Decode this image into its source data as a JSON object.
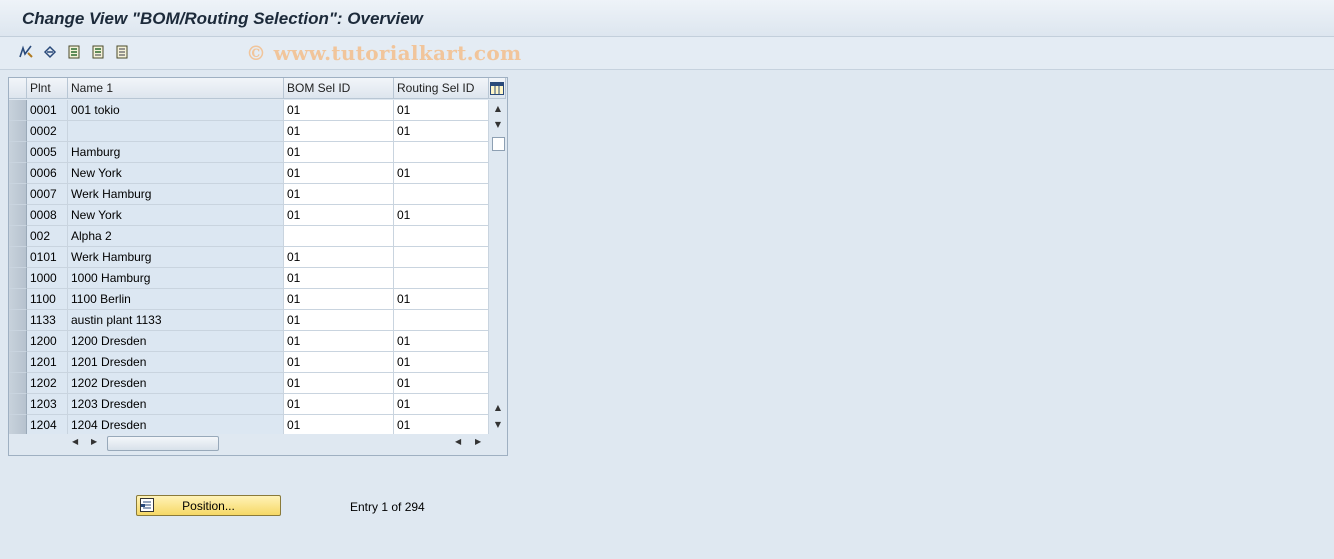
{
  "window": {
    "title": "Change View \"BOM/Routing Selection\": Overview",
    "watermark": "© www.tutorialkart.com"
  },
  "toolbar": {
    "icons": [
      "display-change-icon",
      "undo-icon",
      "select-all-icon",
      "select-block-icon",
      "deselect-all-icon"
    ]
  },
  "table": {
    "headers": {
      "plnt": "Plnt",
      "name": "Name 1",
      "bom": "BOM Sel ID",
      "routing": "Routing Sel ID"
    },
    "rows": [
      {
        "plnt": "0001",
        "name": "001 tokio",
        "bom": "01",
        "routing": "01"
      },
      {
        "plnt": "0002",
        "name": "",
        "bom": "01",
        "routing": "01"
      },
      {
        "plnt": "0005",
        "name": "Hamburg",
        "bom": "01",
        "routing": ""
      },
      {
        "plnt": "0006",
        "name": "New York",
        "bom": "01",
        "routing": "01"
      },
      {
        "plnt": "0007",
        "name": "Werk Hamburg",
        "bom": "01",
        "routing": ""
      },
      {
        "plnt": "0008",
        "name": "New York",
        "bom": "01",
        "routing": "01"
      },
      {
        "plnt": "002",
        "name": "Alpha 2",
        "bom": "",
        "routing": ""
      },
      {
        "plnt": "0101",
        "name": "Werk Hamburg",
        "bom": "01",
        "routing": ""
      },
      {
        "plnt": "1000",
        "name": "1000 Hamburg",
        "bom": "01",
        "routing": ""
      },
      {
        "plnt": "1100",
        "name": "1100 Berlin",
        "bom": "01",
        "routing": "01"
      },
      {
        "plnt": "1133",
        "name": "austin plant 1133",
        "bom": "01",
        "routing": ""
      },
      {
        "plnt": "1200",
        "name": "1200 Dresden",
        "bom": "01",
        "routing": "01"
      },
      {
        "plnt": "1201",
        "name": "1201 Dresden",
        "bom": "01",
        "routing": "01"
      },
      {
        "plnt": "1202",
        "name": "1202 Dresden",
        "bom": "01",
        "routing": "01"
      },
      {
        "plnt": "1203",
        "name": "1203 Dresden",
        "bom": "01",
        "routing": "01"
      },
      {
        "plnt": "1204",
        "name": "1204 Dresden",
        "bom": "01",
        "routing": "01"
      }
    ]
  },
  "footer": {
    "position_label": "Position...",
    "entry_text": "Entry 1 of 294"
  },
  "colors": {
    "background": "#dfe8f1",
    "key_cell": "#dce7f2",
    "button_yellow": "#f6d866"
  }
}
